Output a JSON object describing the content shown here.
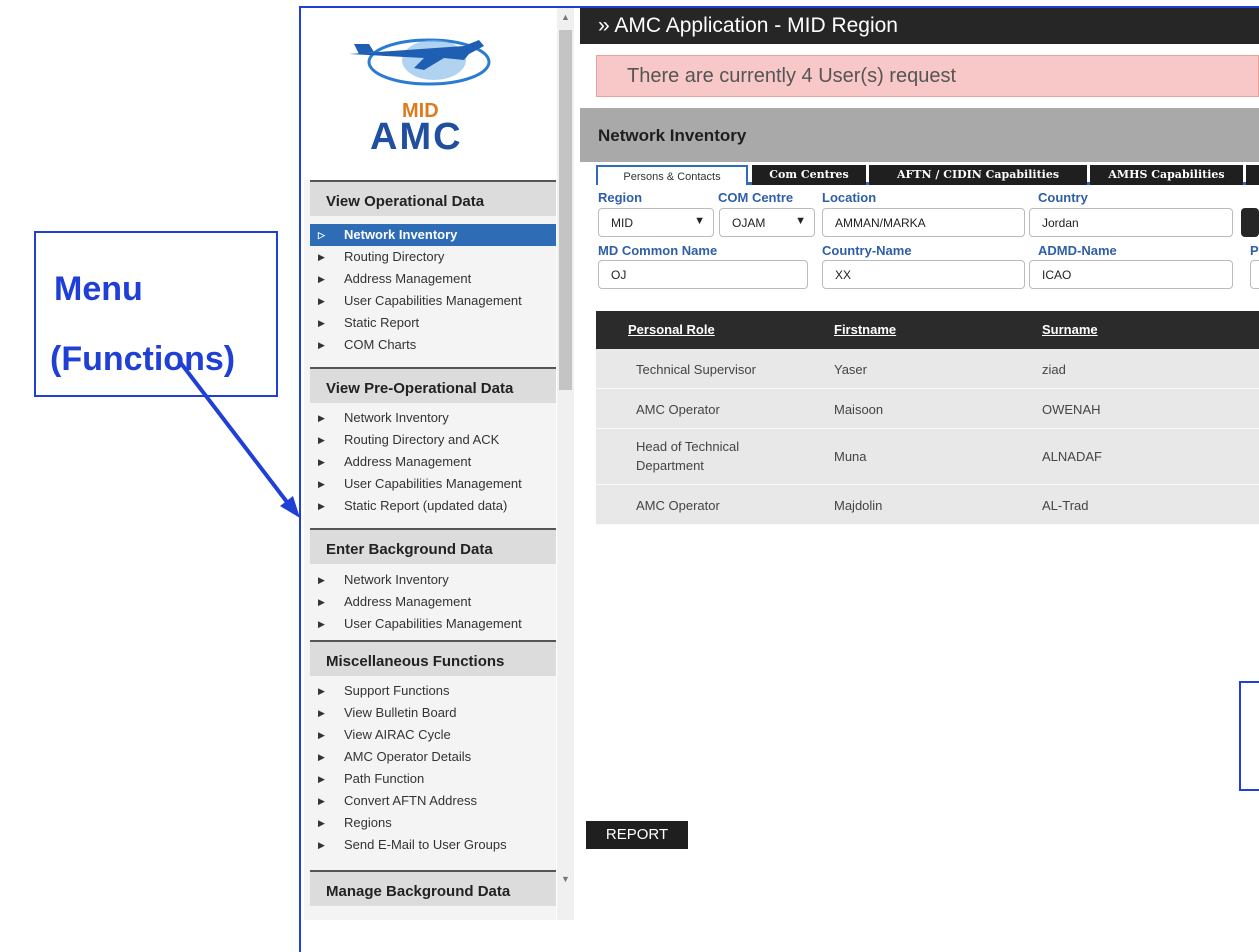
{
  "annotations": {
    "menu_label_line1": "Menu",
    "menu_label_line2": "(Functions)"
  },
  "logo": {
    "line1": "MID",
    "line2": "AMC"
  },
  "sidebar": {
    "sections": [
      {
        "title": "View Operational Data",
        "items": [
          "Network Inventory",
          "Routing Directory",
          "Address Management",
          "User Capabilities Management",
          "Static Report",
          "COM Charts"
        ]
      },
      {
        "title": "View Pre-Operational Data",
        "items": [
          "Network Inventory",
          "Routing Directory and ACK",
          "Address Management",
          "User Capabilities Management",
          "Static Report (updated data)"
        ]
      },
      {
        "title": "Enter Background Data",
        "items": [
          "Network Inventory",
          "Address Management",
          "User Capabilities Management"
        ]
      },
      {
        "title": "Miscellaneous Functions",
        "items": [
          "Support Functions",
          "View Bulletin Board",
          "View AIRAC Cycle",
          "AMC Operator Details",
          "Path Function",
          "Convert AFTN Address",
          "Regions",
          "Send E-Mail to User Groups"
        ]
      },
      {
        "title": "Manage Background Data",
        "items": []
      }
    ]
  },
  "header": {
    "title": "AMC Application - MID Region",
    "chevron": "»"
  },
  "alert": {
    "text": "There are currently 4 User(s) request"
  },
  "panel": {
    "title": "Network Inventory",
    "tabs": [
      "Persons & Contacts",
      "Com Centres",
      "AFTN / CIDIN Capabilities",
      "AMHS Capabilities"
    ],
    "filters": {
      "region": {
        "label": "Region",
        "value": "MID"
      },
      "com_centre": {
        "label": "COM Centre",
        "value": "OJAM"
      },
      "location": {
        "label": "Location",
        "value": "AMMAN/MARKA"
      },
      "country": {
        "label": "Country",
        "value": "Jordan"
      },
      "md_common_name": {
        "label": "MD Common Name",
        "value": "OJ"
      },
      "country_name": {
        "label": "Country-Name",
        "value": "XX"
      },
      "admd_name": {
        "label": "ADMD-Name",
        "value": "ICAO"
      },
      "cut_label": "P"
    },
    "table": {
      "headers": [
        "Personal Role",
        "Firstname",
        "Surname"
      ],
      "rows": [
        [
          "Technical Supervisor",
          "Yaser",
          "ziad"
        ],
        [
          "AMC Operator",
          "Maisoon",
          "OWENAH"
        ],
        [
          "Head of Technical Department",
          "Muna",
          "ALNADAF"
        ],
        [
          "AMC Operator",
          "Majdolin",
          "AL-Trad"
        ]
      ]
    }
  },
  "report_button": "REPORT",
  "colors": {
    "accent": "#2e6db5",
    "annotation": "#1f3fd6",
    "alert_bg": "#f8c8c8"
  }
}
